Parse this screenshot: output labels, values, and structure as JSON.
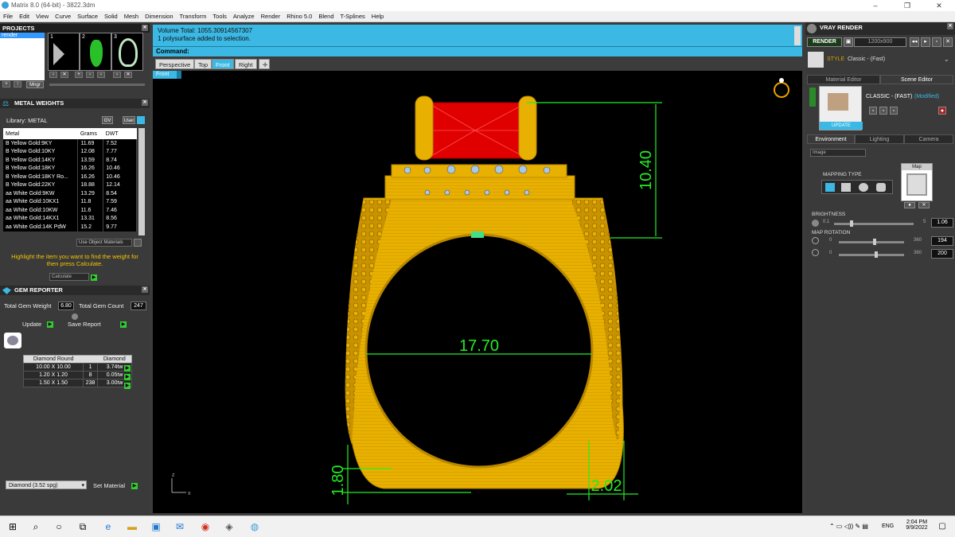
{
  "window": {
    "title": "Matrix 8.0 (64-bit) - 3822.3dm",
    "controls": [
      "–",
      "❐",
      "✕"
    ]
  },
  "menu": [
    "File",
    "Edit",
    "View",
    "Curve",
    "Surface",
    "Solid",
    "Mesh",
    "Dimension",
    "Transform",
    "Tools",
    "Analyze",
    "Render",
    "Rhino 5.0",
    "Blend",
    "T-Splines",
    "Help"
  ],
  "projects": {
    "title": "PROJECTS",
    "item": "render",
    "thumb_numbers": [
      "1",
      "2",
      "3"
    ],
    "mngr_label": "Mngr"
  },
  "metal_weights": {
    "title": "METAL WEIGHTS",
    "library_label": "Library: METAL",
    "library_buttons": [
      "GV",
      "User"
    ],
    "columns": [
      "Metal",
      "Grams",
      "DWT"
    ],
    "rows": [
      [
        "B Yellow Gold:9KY",
        "11.69",
        "7.52"
      ],
      [
        "B Yellow Gold:10KY",
        "12.08",
        "7.77"
      ],
      [
        "B Yellow Gold:14KY",
        "13.59",
        "8.74"
      ],
      [
        "B Yellow Gold:18KY",
        "16.26",
        "10.46"
      ],
      [
        "B Yellow Gold:18KY Ro...",
        "16.26",
        "10.46"
      ],
      [
        "B Yellow Gold:22KY",
        "18.88",
        "12.14"
      ],
      [
        "aa White Gold:9KW",
        "13.29",
        "8.54"
      ],
      [
        "aa White Gold:10KX1",
        "11.8",
        "7.59"
      ],
      [
        "aa White Gold:10KW",
        "11.6",
        "7.46"
      ],
      [
        "aa White Gold:14KX1",
        "13.31",
        "8.56"
      ],
      [
        "aa White Gold:14K PdW",
        "15.2",
        "9.77"
      ]
    ],
    "use_object_label": "Use Object Materials",
    "hint": "Highlight the item you want to find the weight for then press Calculate.",
    "calculate_label": "Calculate"
  },
  "gem_reporter": {
    "title": "GEM REPORTER",
    "total_weight_label": "Total Gem Weight",
    "total_weight_value": "6.80",
    "total_count_label": "Total Gem Count",
    "total_count_value": "247",
    "update_label": "Update",
    "save_report_label": "Save Report",
    "columns": [
      "Diamond Round",
      "",
      "Diamond"
    ],
    "rows": [
      [
        "10.00 X 10.00",
        "1",
        "3.74tw"
      ],
      [
        "1.20 X 1.20",
        "8",
        "0.05tw"
      ],
      [
        "1.50 X 1.50",
        "238",
        "3.00tw"
      ]
    ],
    "material_select": "Diamond    (3.52 spg)",
    "set_material_label": "Set Material"
  },
  "command": {
    "messages": [
      "Volume Total: 1055.30914567307",
      "1 polysurface added to selection."
    ],
    "prompt": "Command:"
  },
  "viewport": {
    "tabs": [
      "Perspective",
      "Top",
      "Front",
      "Right"
    ],
    "active_tab": "Front",
    "view_label": "Front",
    "dimensions": [
      "10.40",
      "17.70",
      "1.80",
      "2.02"
    ],
    "axis_labels": [
      "z",
      "x"
    ]
  },
  "vray": {
    "title": "VRAY RENDER",
    "render_label": "RENDER",
    "resolution": "1200x900",
    "style_label": "STYLE",
    "style_value": "Classic - (Fast)",
    "editor_tabs": [
      "Material Editor",
      "Scene Editor"
    ],
    "preset_name": "CLASSIC - (FAST)",
    "preset_state": "(Modified)",
    "update_label": "UPDATE",
    "env_tabs": [
      "Environment",
      "Lighting",
      "Camera"
    ],
    "env_dropdown": "Image",
    "mapping_type_label": "MAPPING TYPE",
    "map_label": "Map",
    "brightness_label": "BRIGHTNESS",
    "brightness_min": "0.1",
    "brightness_max": "5",
    "brightness_value": "1.06",
    "map_rotation_label": "MAP ROTATION",
    "rotation_rows": [
      {
        "min": "0",
        "max": "360",
        "value": "194"
      },
      {
        "min": "0",
        "max": "360",
        "value": "200"
      }
    ]
  },
  "taskbar": {
    "language": "ENG",
    "time": "2:04 PM",
    "date": "9/9/2022"
  },
  "colors": {
    "accent": "#3bb8e3",
    "dimension": "#22ee22",
    "gold": "#e8b000",
    "ruby": "#e00000",
    "panel": "#3a3a3a"
  }
}
